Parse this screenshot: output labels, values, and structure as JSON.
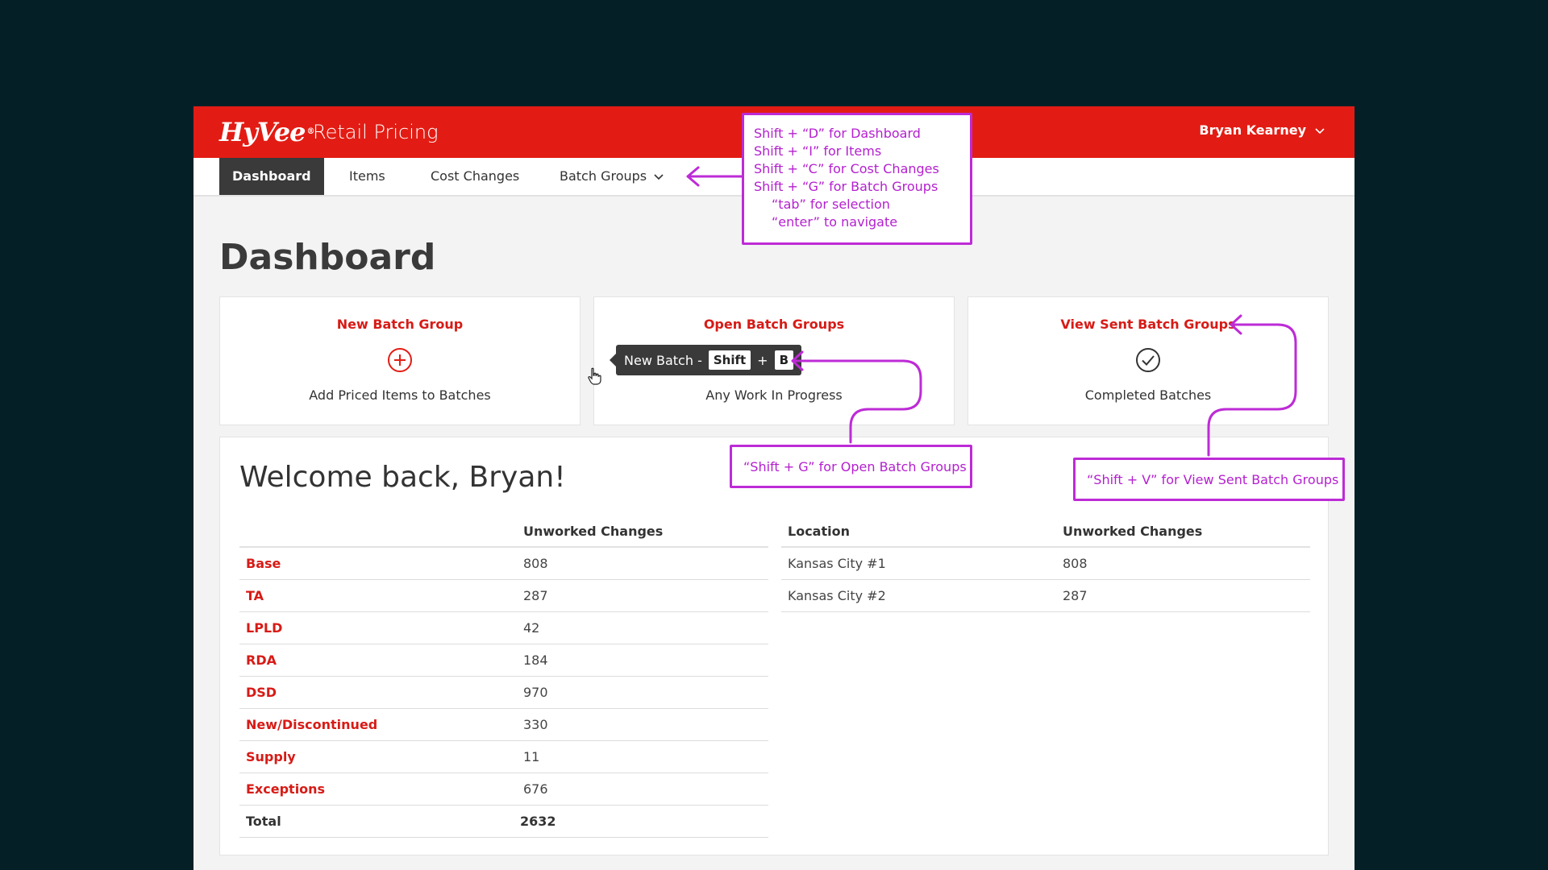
{
  "header": {
    "logo_text": "HyVee",
    "app_title": "Retail Pricing",
    "user_name": "Bryan Kearney"
  },
  "nav": {
    "items": [
      {
        "label": "Dashboard",
        "active": true
      },
      {
        "label": "Items"
      },
      {
        "label": "Cost Changes"
      },
      {
        "label": "Batch Groups"
      }
    ]
  },
  "page": {
    "title": "Dashboard"
  },
  "cards": [
    {
      "title": "New Batch Group",
      "subtitle": "Add Priced Items to Batches",
      "icon": "plus-circle-icon"
    },
    {
      "title": "Open Batch Groups",
      "subtitle": "Any Work In Progress",
      "icon": "ellipsis-circle-icon"
    },
    {
      "title": "View Sent Batch Groups",
      "subtitle": "Completed Batches",
      "icon": "check-circle-icon"
    }
  ],
  "tooltip": {
    "label": "New Batch -",
    "key1": "Shift",
    "plus": "+",
    "key2": "B"
  },
  "welcome": {
    "text": "Welcome back, Bryan!"
  },
  "category_table": {
    "headers": [
      "",
      "Unworked Changes"
    ],
    "rows": [
      {
        "name": "Base",
        "value": "808"
      },
      {
        "name": "TA",
        "value": "287"
      },
      {
        "name": "LPLD",
        "value": "42"
      },
      {
        "name": "RDA",
        "value": "184"
      },
      {
        "name": "DSD",
        "value": "970"
      },
      {
        "name": "New/Discontinued",
        "value": "330"
      },
      {
        "name": "Supply",
        "value": "11"
      },
      {
        "name": "Exceptions",
        "value": "676"
      }
    ],
    "total": {
      "name": "Total",
      "value": "2632"
    }
  },
  "location_table": {
    "headers": [
      "Location",
      "Unworked Changes"
    ],
    "rows": [
      {
        "name": "Kansas City #1",
        "value": "808"
      },
      {
        "name": "Kansas City #2",
        "value": "287"
      }
    ]
  },
  "annotations": {
    "nav_shortcuts": [
      "Shift + “D” for Dashboard",
      "Shift + “I” for Items",
      "Shift + “C” for Cost Changes",
      "Shift + “G” for Batch Groups",
      "“tab” for selection",
      "“enter”  to navigate"
    ],
    "open_batch": "“Shift + G” for Open Batch Groups",
    "view_sent": "“Shift + V” for View Sent Batch Groups"
  },
  "colors": {
    "background": "#051f27",
    "brand_red": "#e21c14",
    "link_red": "#d71b16",
    "annotation_purple": "#bd2bd6",
    "nav_active": "#3a3a3a"
  }
}
